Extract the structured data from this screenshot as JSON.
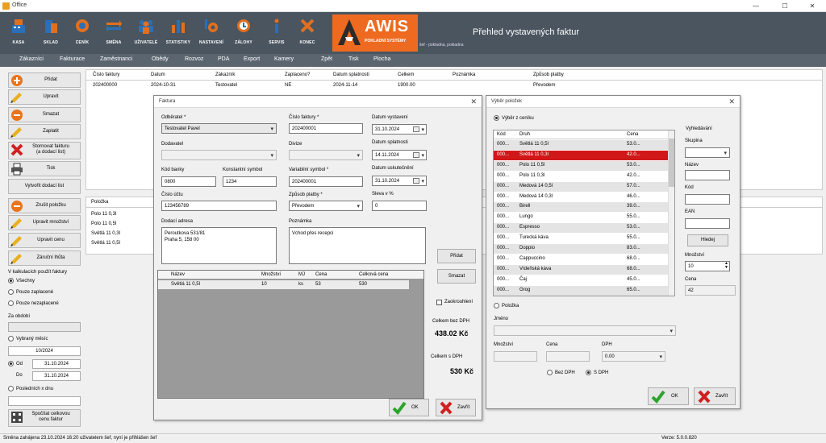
{
  "window": {
    "title": "Office",
    "minimize": "—",
    "maximize": "☐",
    "close": "✕"
  },
  "toolbar": [
    {
      "id": "kasa",
      "label": "KASA"
    },
    {
      "id": "sklad",
      "label": "SKLAD"
    },
    {
      "id": "cenik",
      "label": "CENÍK"
    },
    {
      "id": "smena",
      "label": "SMĚNA"
    },
    {
      "id": "uzivatele",
      "label": "UŽIVATELÉ"
    },
    {
      "id": "statistiky",
      "label": "STATISTIKY"
    },
    {
      "id": "nastaveni",
      "label": "NASTAVENÍ"
    },
    {
      "id": "zalohy",
      "label": "ZÁLOHY"
    },
    {
      "id": "servis",
      "label": "SERVIS"
    },
    {
      "id": "konec",
      "label": "KONEC"
    }
  ],
  "brand": {
    "name": "AWIS",
    "tagline": "POKLADNÍ SYSTÉMY",
    "color": "#ee6a20"
  },
  "header": {
    "title": "Přehled vystavených faktur",
    "subtitle": "šef - pokladna, pokladna"
  },
  "menu": [
    "Zákazníci",
    "Fakturace",
    "Zaměstnanci",
    "Obědy",
    "Rozvoz",
    "PDA",
    "Export",
    "Kamery",
    "Zpět",
    "Tisk",
    "Plocha"
  ],
  "sidebar": {
    "buttons": {
      "pridat": "Přidat",
      "upravit": "Upravit",
      "smazat": "Smazat",
      "zaplatit": "Zaplatit",
      "stornovat_1": "Stornovat fakturu",
      "stornovat_2": "(a dodací list)",
      "tisk": "Tisk",
      "dodaci_list": "Vytvořit dodací list",
      "zrusit_polozku": "Zrušit položku",
      "upravit_mnozstvi": "Upravit množství",
      "upravit_cenu": "Upravit cenu",
      "zarucni_lhuta": "Záruční lhůta",
      "spocitat_1": "Spočítat celkovou",
      "spocitat_2": "cenu faktur"
    },
    "kalkulace_label": "V kalkulacích použít faktury",
    "filter_options": [
      "Všechny",
      "Pouze zaplacené",
      "Pouze nezaplacené"
    ],
    "za_obdobi": "Za období",
    "obdobi_value": "",
    "vybrany_mesic": "Vybraný měsíc",
    "mesic_value": "10/2024",
    "od_label": "Od",
    "od_value": "31.10.2024",
    "do_label": "Do",
    "do_value": "31.10.2024",
    "poslednich": "Posledních x dnu",
    "poslednich_value": ""
  },
  "invoices": {
    "columns": [
      "Číslo faktury",
      "Datum",
      "Zákazník",
      "Zaplaceno?",
      "Datum splatnosti",
      "Celkem",
      "Poznámka",
      "Způsob platby"
    ],
    "rows": [
      [
        "202400000",
        "2024-10-31",
        "Testovatel",
        "NE",
        "2024-11-14",
        "1900.00",
        "",
        "Převodem"
      ]
    ]
  },
  "items_panel": {
    "header": "Položka",
    "rows": [
      "Polo 11 0,3l",
      "Polo 11 0,5l",
      "Světlá 11 0,3l",
      "Světlá 11 0,5l"
    ]
  },
  "faktura": {
    "title": "Faktura",
    "odberatel_label": "Odběratel *",
    "odberatel": "Testovatel Pavel",
    "dodavatel_label": "Dodavatel",
    "kod_banky_label": "Kód banky",
    "kod_banky": "0800",
    "konst_label": "Konstantní symbol",
    "konst": "1234",
    "cislo_uctu_label": "Číslo účtu",
    "cislo_uctu": "123456789",
    "adresa_label": "Dodací adresa",
    "adresa_1": "Peroutkova 531/81",
    "adresa_2": "Praha 5, 158 00",
    "cislo_faktury_label": "Číslo faktury *",
    "cislo_faktury": "202400001",
    "divize_label": "Divize",
    "var_label": "Variabilní symbol *",
    "var": "202400001",
    "zpusob_label": "Způsob platby *",
    "zpusob": "Převodem",
    "poznamka_label": "Poznámka",
    "poznamka": "Vchod přes recepci",
    "vystaveni_label": "Datum vystavení",
    "vystaveni": "31.10.2024",
    "splatnost_label": "Datum splatnosti",
    "splatnost": "14.11.2024",
    "uskutecneni_label": "Datum uskutečnění",
    "uskutecneni": "31.10.2024",
    "sleva_label": "Sleva v %",
    "sleva": "0",
    "table_columns": [
      "Název",
      "Množství",
      "MJ",
      "Cena",
      "Celková cena"
    ],
    "table_rows": [
      [
        "Světlá 11 0,5l",
        "10",
        "ks",
        "53",
        "530"
      ]
    ],
    "pridat": "Přidat",
    "smazat": "Smazat",
    "zaokrouhleni": "Zaokrouhlení",
    "bez_dph_label": "Celkem bez DPH",
    "bez_dph": "438.02 Kč",
    "s_dph_label": "Celkem s DPH",
    "s_dph": "530 Kč",
    "ok": "OK",
    "zavrit": "Zavřít"
  },
  "vyber": {
    "title": "Výběr položek",
    "z_ceniku": "Výběr z ceníku",
    "columns": [
      "Kód",
      "Druh",
      "Cena"
    ],
    "rows": [
      [
        "000...",
        "Světlá 11 0,5l",
        "53.0..."
      ],
      [
        "000...",
        "Světlá 11 0,3l",
        "42.0..."
      ],
      [
        "000...",
        "Polo 11 0,5l",
        "53.0..."
      ],
      [
        "000...",
        "Polo 11 0,3l",
        "42.0..."
      ],
      [
        "000...",
        "Medová 14 0,5l",
        "57.0..."
      ],
      [
        "000...",
        "Medová 14 0,3l",
        "46.0..."
      ],
      [
        "000...",
        "Birell",
        "39.0..."
      ],
      [
        "000...",
        "Lungo",
        "55.0..."
      ],
      [
        "000...",
        "Espresso",
        "53.0..."
      ],
      [
        "000...",
        "Turecká káva",
        "55.0..."
      ],
      [
        "000...",
        "Doppio",
        "83.0..."
      ],
      [
        "000...",
        "Cappuccino",
        "68.0..."
      ],
      [
        "000...",
        "Vídeňská káva",
        "68.0..."
      ],
      [
        "000...",
        "Čaj",
        "45.0..."
      ],
      [
        "000...",
        "Grog",
        "65.0..."
      ]
    ],
    "selected_row": 1,
    "search_title": "Vyhledávání",
    "skupina": "Skupina",
    "nazev": "Název",
    "kod": "Kód",
    "ean": "EAN",
    "hledej": "Hledej",
    "mnozstvi_label": "Množství",
    "mnozstvi": "10",
    "cena_label": "Cena",
    "cena": "42",
    "polozka": "Položka",
    "jmeno": "Jméno",
    "mnozstvi2": "Množství",
    "cena2": "Cena",
    "dph": "DPH",
    "dph_value": "0.00",
    "bez_dph": "Bez DPH",
    "s_dph": "S DPH",
    "ok": "OK",
    "zavrit": "Zavřít"
  },
  "status": {
    "left": "Směna zahájena 23.10.2024 16:20 uživatelem šef, nyní je přihlášen šef",
    "right": "Verze: 5.0.0.820"
  }
}
